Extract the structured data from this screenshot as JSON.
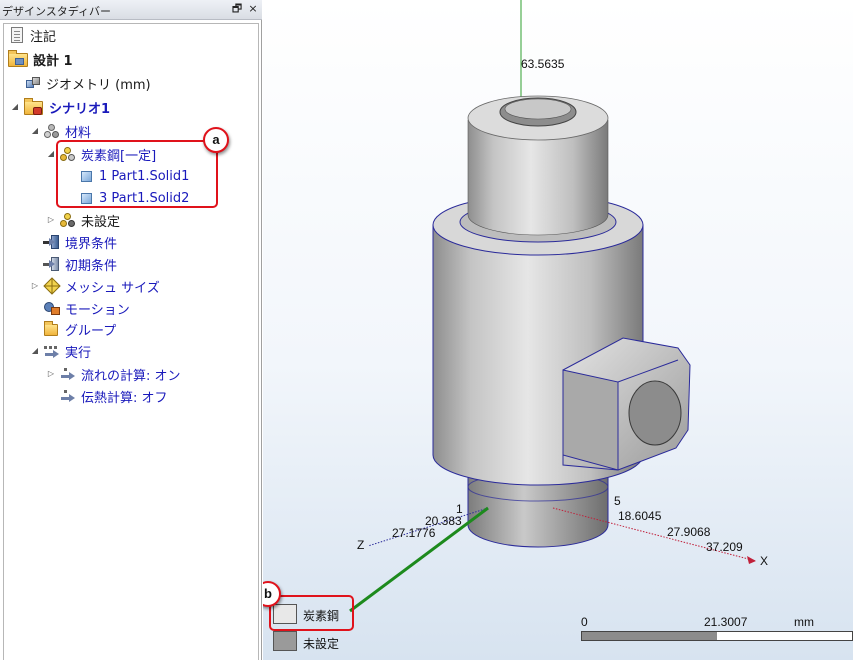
{
  "panel": {
    "title": "デザインスタディバー",
    "pin_glyph": "🗗",
    "close_glyph": "×"
  },
  "tree": {
    "annotations": "注記",
    "design": "設計 1",
    "geometry": "ジオメトリ (mm)",
    "scenario": "シナリオ1",
    "materials": "材料",
    "carbon_steel": "炭素鋼[一定]",
    "part1": "1 Part1.Solid1",
    "part2": "3 Part1.Solid2",
    "unset": "未設定",
    "boundary": "境界条件",
    "initial": "初期条件",
    "mesh": "メッシュ サイズ",
    "motion": "モーション",
    "groups": "グループ",
    "run": "実行",
    "flow_calc": "流れの計算: オン",
    "heat_calc": "伝熱計算: オフ"
  },
  "callouts": {
    "a": "a",
    "b": "b"
  },
  "viewport": {
    "dims": {
      "top": "63.5635",
      "d1": "1",
      "d2": "20.383",
      "d3": "27.1776",
      "d4": "18.6045",
      "d5": "27.9068",
      "d6": "37.209",
      "d7": "5"
    },
    "axis_z": "Z",
    "axis_x": "X",
    "axis_y_color": "#2fa02f",
    "axis_x_color": "#c0203a",
    "axis_z_color": "#2b2b9a",
    "accent_red": "#e0121b"
  },
  "legend": {
    "items": [
      {
        "label": "炭素鋼",
        "color": "#e8e8e8"
      },
      {
        "label": "未設定",
        "color": "#9a9a9a"
      }
    ],
    "scale_start": "0",
    "scale_mid": "21.3007",
    "scale_unit": "mm"
  }
}
